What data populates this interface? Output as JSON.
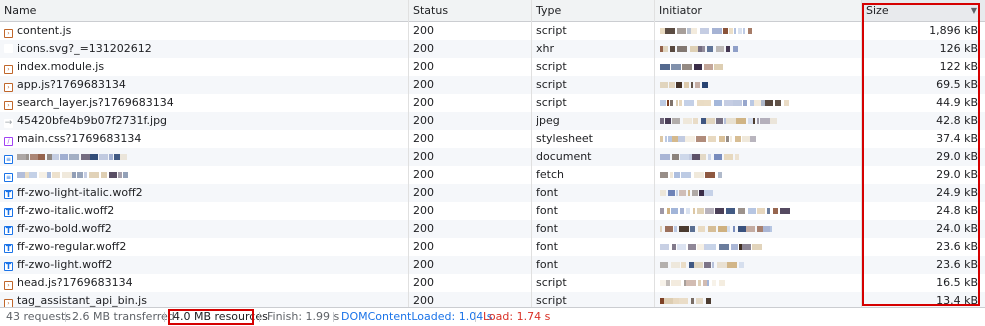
{
  "columns": {
    "name": "Name",
    "status": "Status",
    "type": "Type",
    "initiator": "Initiator",
    "size": "Size",
    "sort_indicator": "▼"
  },
  "rows": [
    {
      "icon": "script-icon",
      "name": "content.js",
      "status": "200",
      "type": "script",
      "size": "1,896 kB"
    },
    {
      "icon": "none",
      "name": "icons.svg?_=131202612",
      "status": "200",
      "type": "xhr",
      "size": "126 kB"
    },
    {
      "icon": "script-icon",
      "name": "index.module.js",
      "status": "200",
      "type": "script",
      "size": "122 kB"
    },
    {
      "icon": "script-icon",
      "name": "app.js?1769683134",
      "status": "200",
      "type": "script",
      "size": "69.5 kB"
    },
    {
      "icon": "script-icon",
      "name": "search_layer.js?1769683134",
      "status": "200",
      "type": "script",
      "size": "44.9 kB"
    },
    {
      "icon": "image-icon",
      "name": "45420bfe4b9b07f2731f.jpg",
      "status": "200",
      "type": "jpeg",
      "size": "42.8 kB"
    },
    {
      "icon": "stylesheet-icon",
      "name": "main.css?1769683134",
      "status": "200",
      "type": "stylesheet",
      "size": "37.4 kB"
    },
    {
      "icon": "document-icon",
      "name": "",
      "status": "200",
      "type": "document",
      "size": "29.0 kB"
    },
    {
      "icon": "document-icon",
      "name": "",
      "status": "200",
      "type": "fetch",
      "size": "29.0 kB"
    },
    {
      "icon": "font-icon",
      "name": "ff-zwo-light-italic.woff2",
      "status": "200",
      "type": "font",
      "size": "24.9 kB"
    },
    {
      "icon": "font-icon",
      "name": "ff-zwo-italic.woff2",
      "status": "200",
      "type": "font",
      "size": "24.8 kB"
    },
    {
      "icon": "font-icon",
      "name": "ff-zwo-bold.woff2",
      "status": "200",
      "type": "font",
      "size": "24.0 kB"
    },
    {
      "icon": "font-icon",
      "name": "ff-zwo-regular.woff2",
      "status": "200",
      "type": "font",
      "size": "23.6 kB"
    },
    {
      "icon": "font-icon",
      "name": "ff-zwo-light.woff2",
      "status": "200",
      "type": "font",
      "size": "23.6 kB"
    },
    {
      "icon": "script-icon",
      "name": "head.js?1769683134",
      "status": "200",
      "type": "script",
      "size": "16.5 kB"
    },
    {
      "icon": "script-icon",
      "name": "tag_assistant_api_bin.js",
      "status": "200",
      "type": "script",
      "size": "13.4 kB"
    }
  ],
  "status_bar": {
    "requests": "43 requests",
    "transferred": "2.6 MB transferred",
    "resources": "4.0 MB resources",
    "finish": "Finish: 1.99 s",
    "dom_content_loaded": "DOMContentLoaded: 1.04 s",
    "load": "Load: 1.74 s"
  },
  "colors": {
    "highlight_box": "#d50000",
    "dom_content_loaded": "#1a73e8",
    "load": "#d93025"
  }
}
